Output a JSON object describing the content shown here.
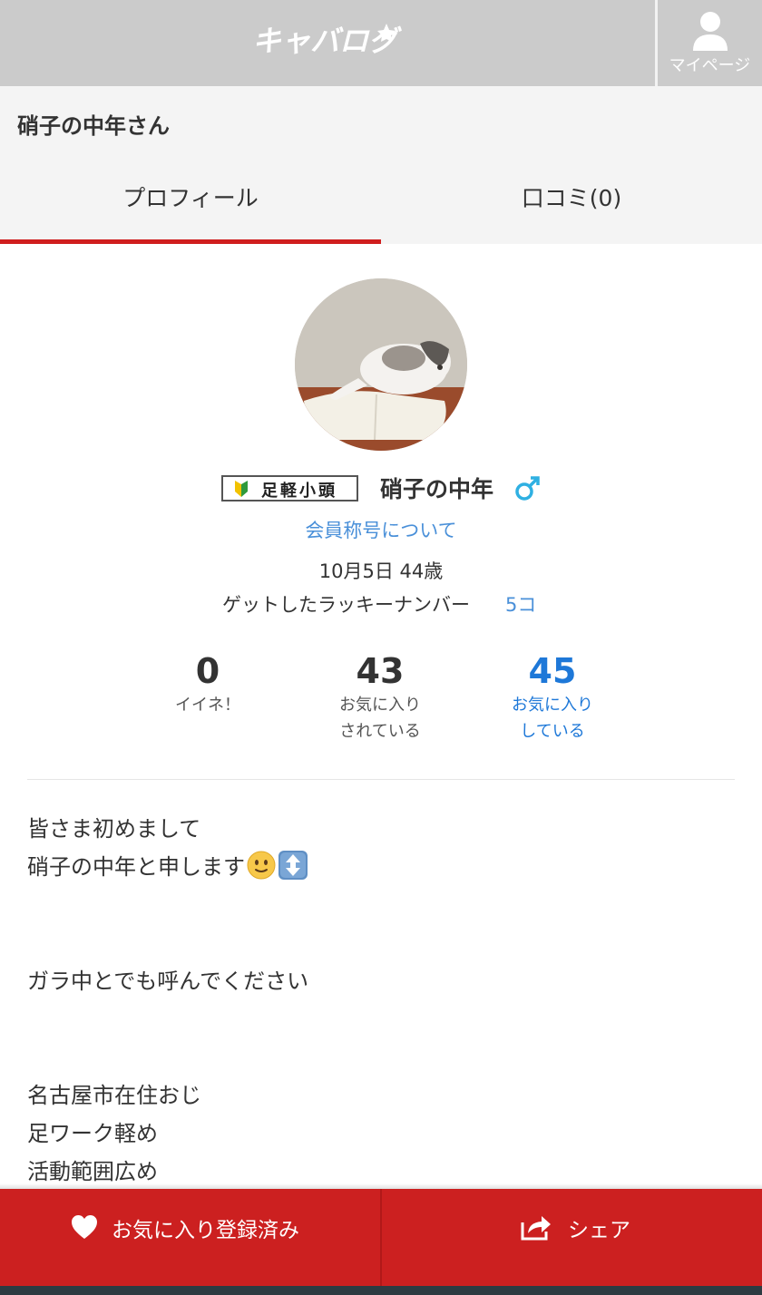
{
  "header": {
    "logo_text": "キャバログ",
    "mypage_label": "マイページ"
  },
  "page": {
    "title": "硝子の中年さん"
  },
  "tabs": [
    {
      "label": "プロフィール",
      "active": true
    },
    {
      "label": "口コミ(0)",
      "active": false
    }
  ],
  "profile": {
    "rank_badge": "足軽小頭",
    "name": "硝子の中年",
    "gender_icon": "male-symbol",
    "rank_link": "会員称号について",
    "birthday": "10月5日 44歳",
    "lucky_label": "ゲットしたラッキーナンバー",
    "lucky_count": "5コ"
  },
  "stats": [
    {
      "value": "0",
      "label": "イイネ！"
    },
    {
      "value": "43",
      "label": "お気に入り\nされている"
    },
    {
      "value": "45",
      "label": "お気に入り\nしている"
    }
  ],
  "bio": {
    "line1": "皆さま初めまして",
    "line2": "硝子の中年と申します",
    "line3": "ガラ中とでも呼んでください",
    "line4": "名古屋市在住おじ",
    "line5": "足ワーク軽め",
    "line6": "活動範囲広め"
  },
  "bottom_bar": {
    "favorite_label": "お気に入り登録済み",
    "share_label": "シェア"
  },
  "colors": {
    "accent_red": "#cc2020",
    "link_blue": "#4a90d9",
    "stat_blue": "#1e78d8",
    "header_gray": "#cbcbcb"
  }
}
